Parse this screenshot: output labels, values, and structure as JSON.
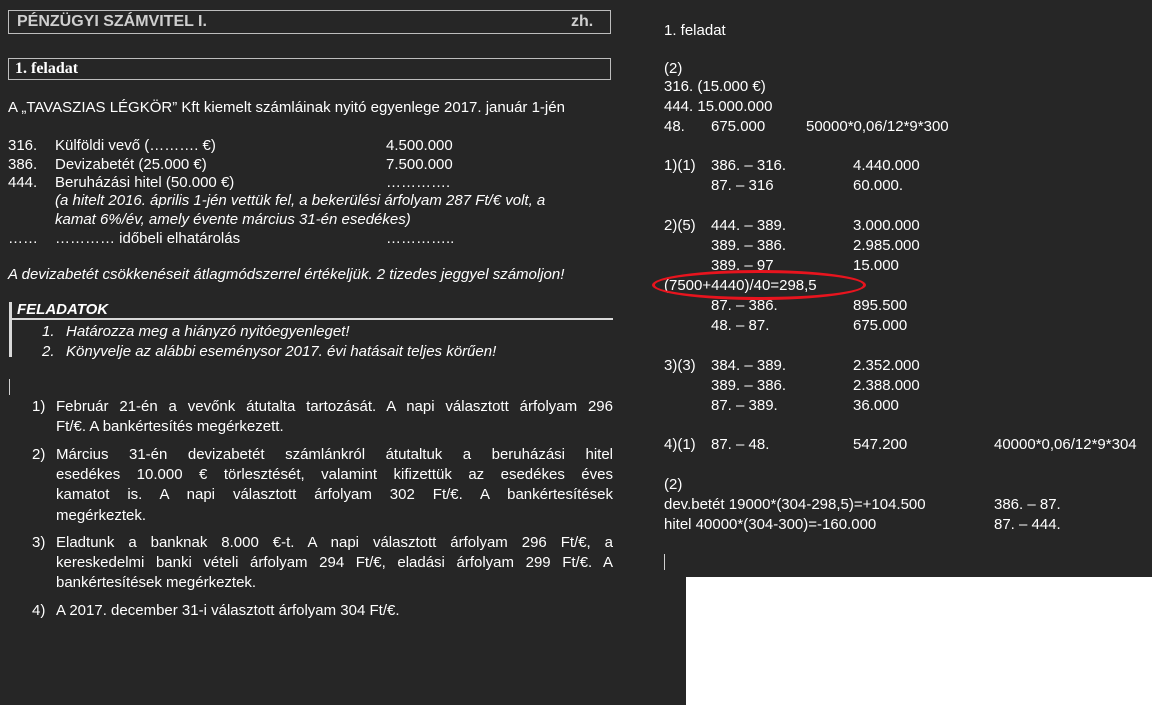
{
  "left": {
    "header_title": "PÉNZÜGYI SZÁMVITEL I.",
    "header_tag": "zh.",
    "task_title": "1. feladat",
    "intro": "A „TAVASZIAS LÉGKÖR” Kft kiemelt számláinak nyitó egyenlege 2017. január 1-jén",
    "accounts": [
      {
        "code": "316.",
        "name": "Külföldi vevő (………. €)",
        "value": "4.500.000"
      },
      {
        "code": "386.",
        "name": "Devizabetét (25.000 €)",
        "value": "7.500.000"
      },
      {
        "code": "444.",
        "name": "Beruházási hitel (50.000 €)",
        "value": "…………."
      }
    ],
    "note_line1": "(a hitelt 2016. április 1-jén vettük fel, a bekerülési árfolyam 287 Ft/€ volt, a",
    "note_line2": "kamat 6%/év, amely évente március 31-én esedékes)",
    "accrual_code": "……",
    "accrual_name": "………… időbeli elhatárolás",
    "accrual_value": "…………..",
    "method_note": "A devizabetét csökkenéseit átlagmódszerrel értékeljük. 2 tizedes jeggyel számoljon!",
    "tasks_title": "FELADATOK",
    "tasks": [
      {
        "num": "1.",
        "text": "Határozza meg a hiányzó nyitóegyenleget!"
      },
      {
        "num": "2.",
        "text": "Könyvelje az alábbi eseménysor 2017. évi hatásait teljes körűen!"
      }
    ],
    "events": [
      {
        "num": "1)",
        "lines": [
          "Február 21-én a vevőnk átutalta tartozását. A napi választott árfolyam 296",
          "Ft/€. A bankértesítés megérkezett."
        ]
      },
      {
        "num": "2)",
        "lines": [
          "Március 31-én devizabetét számlánkról átutaltuk a beruházási hitel",
          "esedékes 10.000 € törlesztését, valamint kifizettük az esedékes éves",
          "kamatot is. A napi választott árfolyam 302 Ft/€. A bankértesítések",
          "megérkeztek."
        ]
      },
      {
        "num": "3)",
        "lines": [
          "Eladtunk a banknak 8.000 €-t. A napi választott árfolyam 296 Ft/€, a",
          "kereskedelmi banki vételi árfolyam 294 Ft/€, eladási árfolyam 299 Ft/€. A",
          "bankértesítések megérkeztek."
        ]
      },
      {
        "num": "4)",
        "lines": [
          "A 2017. december 31-i választott árfolyam 304 Ft/€."
        ]
      }
    ]
  },
  "right": {
    "title": "1. feladat",
    "s1_label": "(2)",
    "s1_l1": "316. (15.000 €)",
    "s1_l2": "444. 15.000.000",
    "s1_l3a": "48.",
    "s1_l3b": "675.000",
    "s1_l3c": "50000*0,06/12*9*300",
    "e1_label": "1)(1)",
    "e1_r1a": "386. – 316.",
    "e1_r1b": "4.440.000",
    "e1_r2a": "87. – 316",
    "e1_r2b": "60.000.",
    "e2_label": "2)(5)",
    "e2_r1a": "444. – 389.",
    "e2_r1b": "3.000.000",
    "e2_r2a": "389. – 386.",
    "e2_r2b": "2.985.000",
    "e2_r3a": "389. – 97",
    "e2_r3b": "15.000",
    "e2_calc": "(7500+4440)/40=298,5",
    "e2_r4a": "87. – 386.",
    "e2_r4b": "895.500",
    "e2_r5a": "48. – 87.",
    "e2_r5b": "675.000",
    "e3_label": "3)(3)",
    "e3_r1a": "384. – 389.",
    "e3_r1b": "2.352.000",
    "e3_r2a": "389. – 386.",
    "e3_r2b": "2.388.000",
    "e3_r3a": "87. – 389.",
    "e3_r3b": "36.000",
    "e4_label": "4)(1)",
    "e4_r1a": "87. – 48.",
    "e4_r1b": "547.200",
    "e4_r1c": "40000*0,06/12*9*304",
    "e4b_label": "(2)",
    "e4b_r1a": "dev.betét 19000*(304-298,5)=+104.500",
    "e4b_r1b": "386. – 87.",
    "e4b_r2a": "hitel 40000*(304-300)=-160.000",
    "e4b_r2b": "87. – 444."
  }
}
